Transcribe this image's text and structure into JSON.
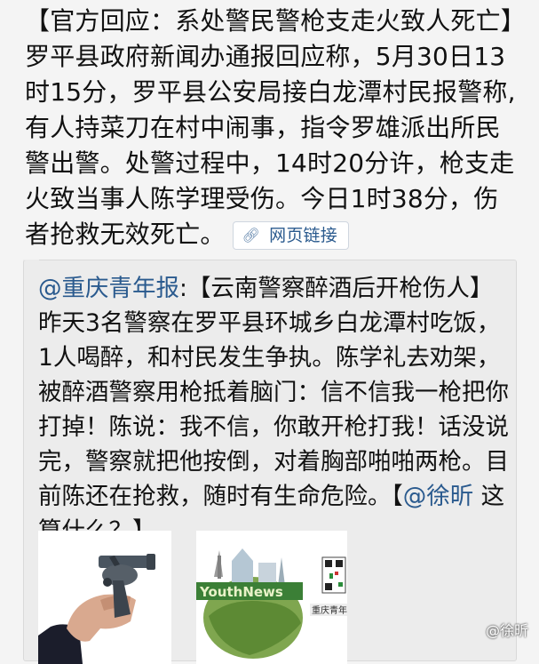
{
  "post": {
    "text": "【官方回应：系处警民警枪支走火致人死亡】罗平县政府新闻办通报回应称，5月30日13时15分，罗平县公安局接白龙潭村民报警称,有人持菜刀在村中闹事，指令罗雄派出所民警出警。处警过程中，14时20分许，枪支走火致当事人陈学理受伤。今日1时38分，伤者抢救无效死亡。",
    "link_label": "网页链接",
    "link_icon": "link-icon"
  },
  "quote": {
    "author": "@重庆青年报",
    "sep": ":",
    "text": "【云南警察醉酒后开枪伤人】昨天3名警察在罗平县环城乡白龙潭村吃饭，1人喝醉，和村民发生争执。陈学礼去劝架，被醉酒警察用枪抵着脑门：信不信我一枪把你打掉！陈说：我不信，你敢开枪打我！话没说完，警察就把他按倒，对着胸部啪啪两枪。目前陈还在抢救，随时有生命危险。【",
    "mention": "@徐昕",
    "tail": " 这算什么？】",
    "image_2_text": "YouthNews",
    "image_2_caption": "重庆青年"
  },
  "watermark": "@徐昕"
}
